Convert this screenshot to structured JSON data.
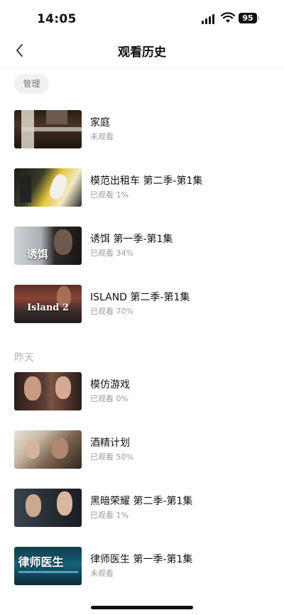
{
  "status_bar": {
    "time": "14:05",
    "battery": "95"
  },
  "nav": {
    "title": "观看历史"
  },
  "manage_label": "管理",
  "sections": {
    "today_items": [
      {
        "title": "家庭",
        "progress": "未观看"
      },
      {
        "title": "模范出租车 第二季-第1集",
        "progress": "已观看 1%"
      },
      {
        "title": "诱饵 第一季-第1集",
        "progress": "已观看 34%",
        "thumb_text": "诱饵"
      },
      {
        "title": "ISLAND 第二季-第1集",
        "progress": "已观看 70%",
        "thumb_text": "Island 2"
      }
    ],
    "yesterday_header": "昨天",
    "yesterday_items": [
      {
        "title": "模仿游戏",
        "progress": "已观看 0%"
      },
      {
        "title": "酒精计划",
        "progress": "已观看 50%"
      },
      {
        "title": "黑暗荣耀 第二季-第1集",
        "progress": "已观看 1%"
      },
      {
        "title": "律师医生 第一季-第1集",
        "progress": "未观看",
        "thumb_text": "律师医生"
      }
    ]
  },
  "colors": {
    "accent_text": "#111111",
    "secondary_text": "#9b9b9b",
    "section_header": "#b5b5b5",
    "chip_bg": "#f1f1f1"
  }
}
